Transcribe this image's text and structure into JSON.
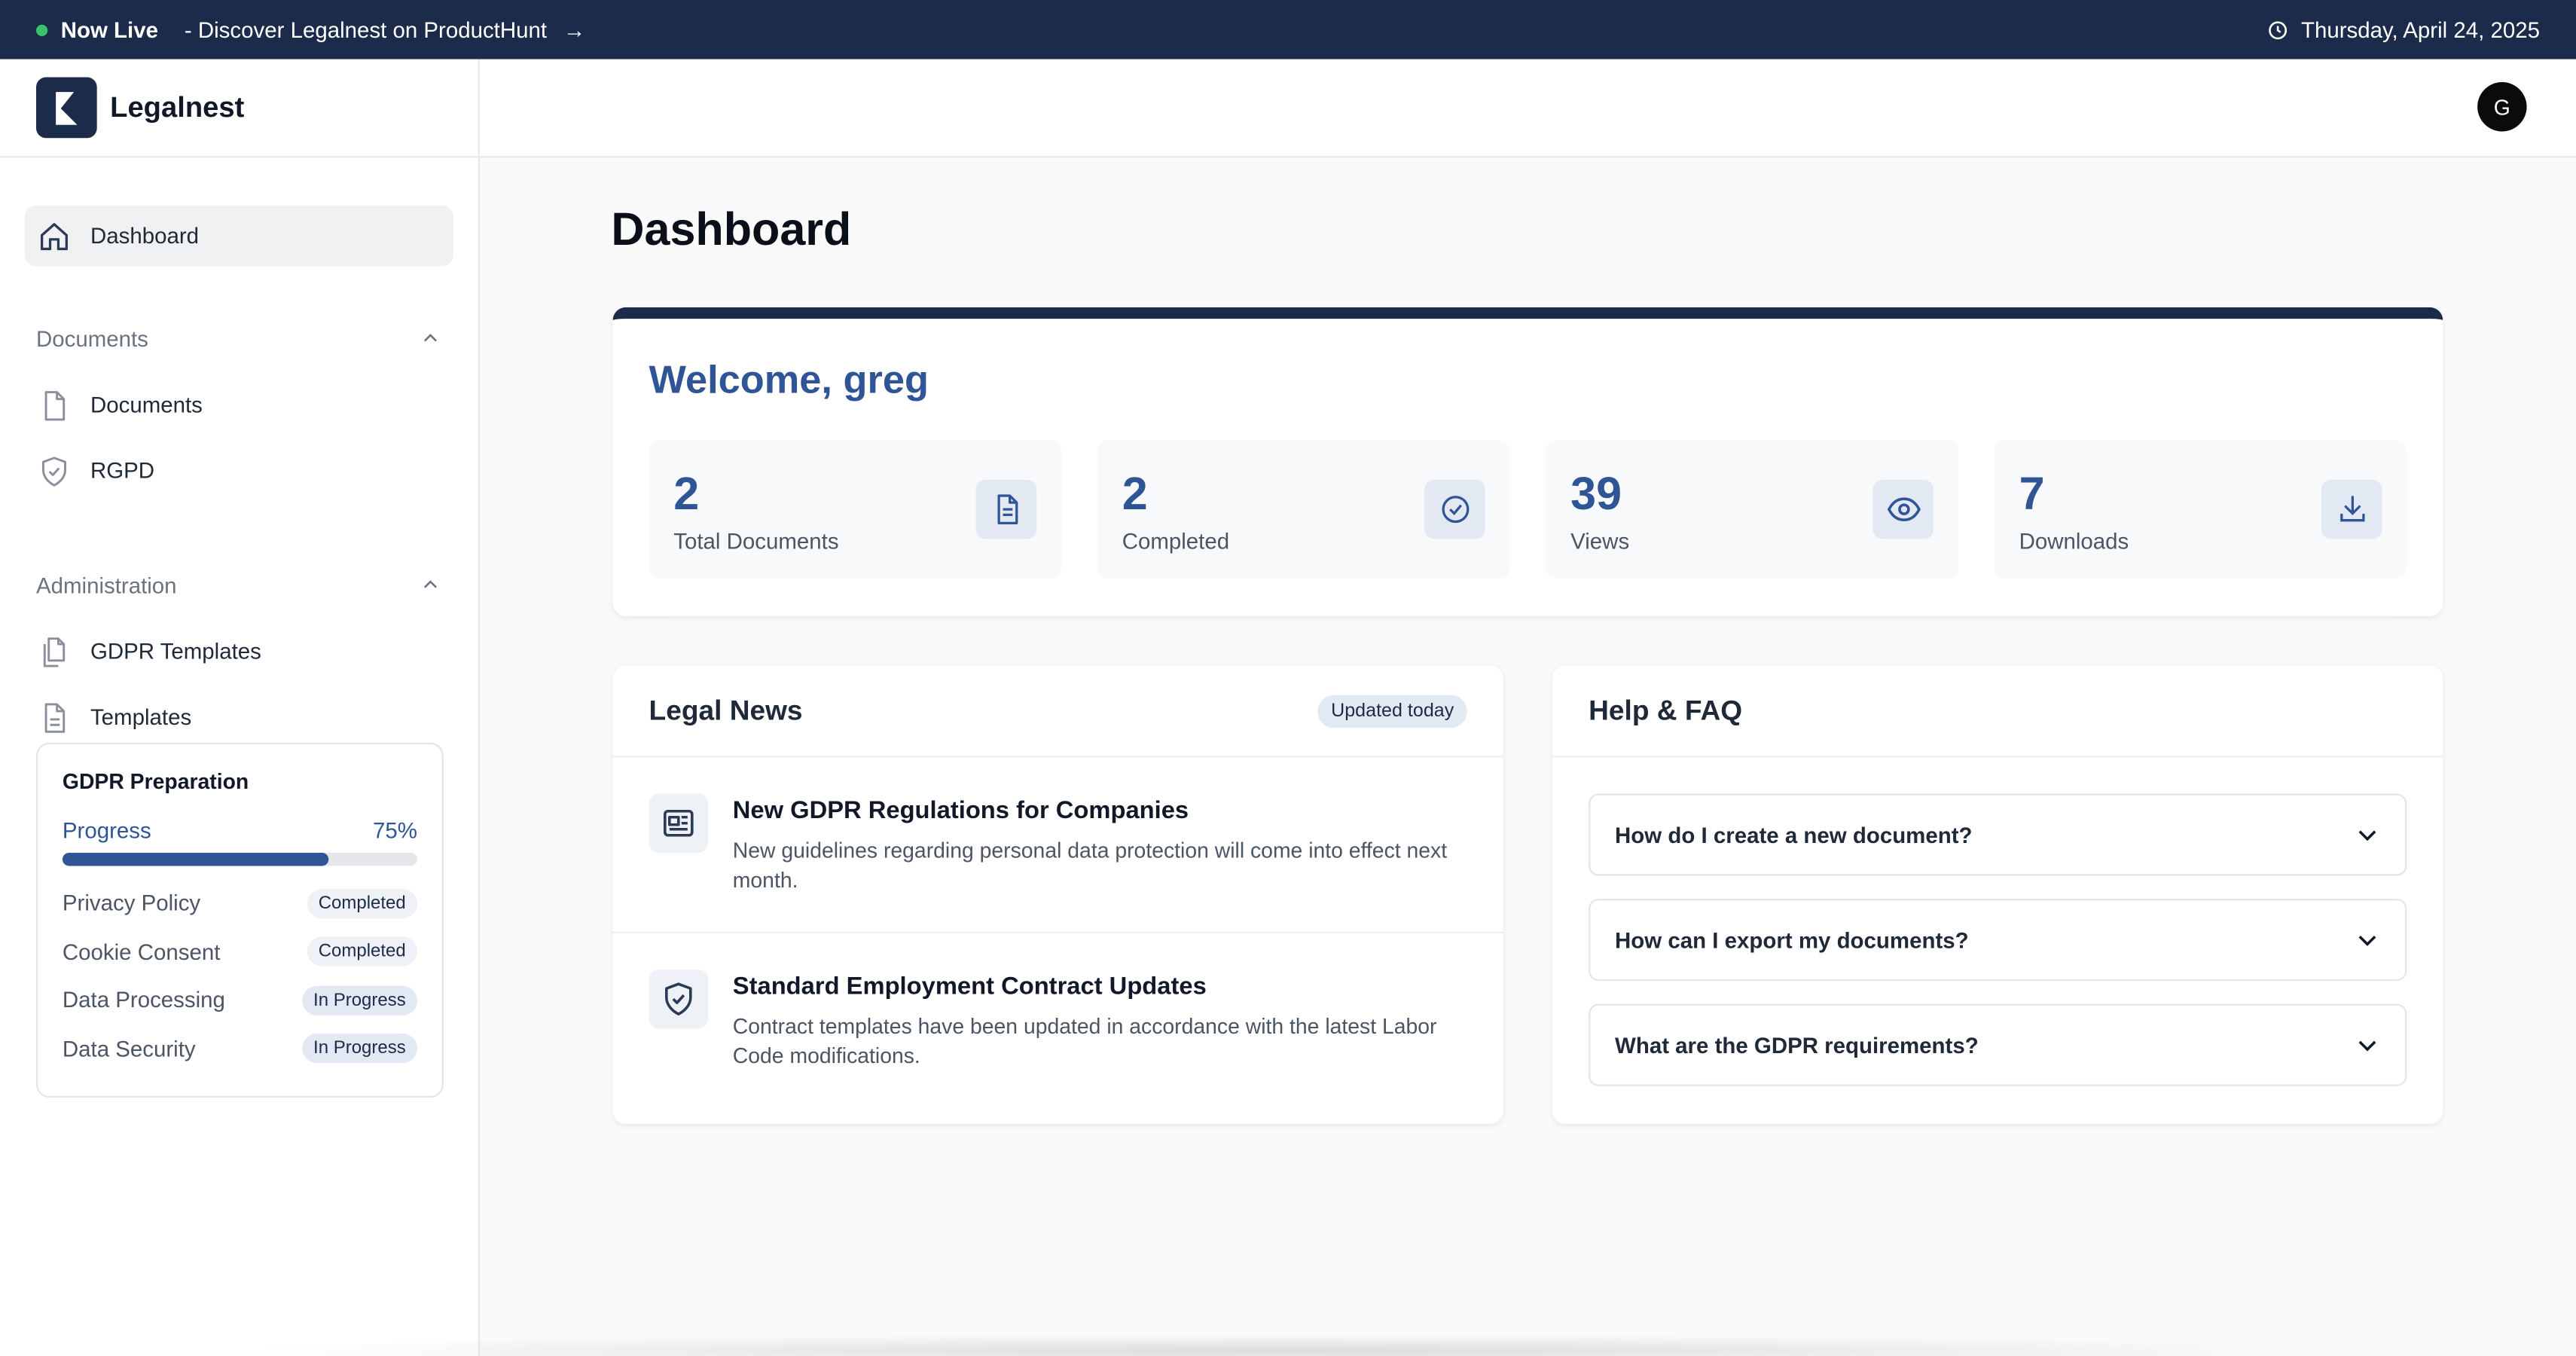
{
  "banner": {
    "live_label": "Now Live",
    "message": "- Discover Legalnest on ProductHunt",
    "arrow": "→",
    "date": "Thursday, April 24, 2025"
  },
  "brand": {
    "name": "Legalnest"
  },
  "header": {
    "avatar_initial": "G"
  },
  "sidebar": {
    "dashboard": "Dashboard",
    "documents_section": "Documents",
    "documents_items": [
      "Documents",
      "RGPD"
    ],
    "admin_section": "Administration",
    "admin_items": [
      "GDPR Templates",
      "Templates"
    ]
  },
  "gdpr": {
    "title": "GDPR Preparation",
    "progress_label": "Progress",
    "progress_value": "75%",
    "progress_fraction": 0.75,
    "tasks": [
      {
        "name": "Privacy Policy",
        "status": "Completed"
      },
      {
        "name": "Cookie Consent",
        "status": "Completed"
      },
      {
        "name": "Data Processing",
        "status": "In Progress"
      },
      {
        "name": "Data Security",
        "status": "In Progress"
      }
    ]
  },
  "main": {
    "title": "Dashboard",
    "welcome": "Welcome, greg",
    "stats": [
      {
        "value": "2",
        "label": "Total Documents",
        "icon": "document-icon"
      },
      {
        "value": "2",
        "label": "Completed",
        "icon": "check-circle-icon"
      },
      {
        "value": "39",
        "label": "Views",
        "icon": "eye-icon"
      },
      {
        "value": "7",
        "label": "Downloads",
        "icon": "download-icon"
      }
    ]
  },
  "news": {
    "title": "Legal News",
    "badge": "Updated today",
    "items": [
      {
        "title": "New GDPR Regulations for Companies",
        "desc": "New guidelines regarding personal data protection will come into effect next month.",
        "icon": "newspaper-icon"
      },
      {
        "title": "Standard Employment Contract Updates",
        "desc": "Contract templates have been updated in accordance with the latest Labor Code modifications.",
        "icon": "shield-check-icon"
      }
    ]
  },
  "faq": {
    "title": "Help & FAQ",
    "items": [
      "How do I create a new document?",
      "How can I export my documents?",
      "What are the GDPR requirements?"
    ]
  },
  "colors": {
    "navy": "#1c2b4a",
    "accent": "#2f5597",
    "live": "#35c46a"
  }
}
